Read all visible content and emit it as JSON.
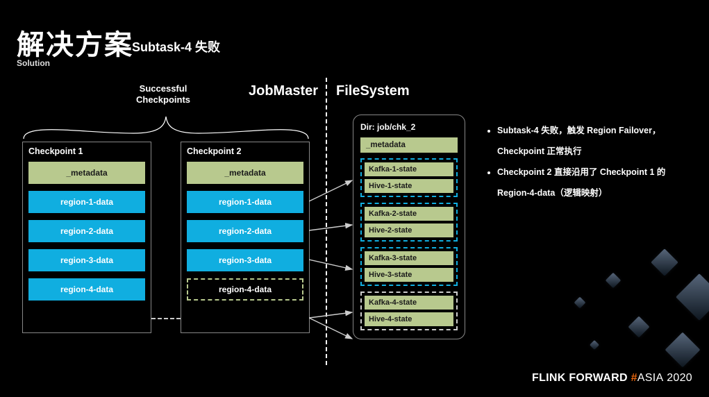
{
  "title": "解决方案",
  "title_en": "Solution",
  "scenario": "Subtask-4 失败",
  "labels": {
    "jobmaster": "JobMaster",
    "filesystem": "FileSystem",
    "successful_checkpoints_l1": "Successful",
    "successful_checkpoints_l2": "Checkpoints"
  },
  "checkpoints": [
    {
      "name": "Checkpoint 1",
      "rows": [
        {
          "label": "_metadata",
          "kind": "meta"
        },
        {
          "label": "region-1-data",
          "kind": "region"
        },
        {
          "label": "region-2-data",
          "kind": "region"
        },
        {
          "label": "region-3-data",
          "kind": "region"
        },
        {
          "label": "region-4-data",
          "kind": "region"
        }
      ]
    },
    {
      "name": "Checkpoint 2",
      "rows": [
        {
          "label": "_metadata",
          "kind": "meta"
        },
        {
          "label": "region-1-data",
          "kind": "region"
        },
        {
          "label": "region-2-data",
          "kind": "region"
        },
        {
          "label": "region-3-data",
          "kind": "region"
        },
        {
          "label": "region-4-data",
          "kind": "region-dashed"
        }
      ]
    }
  ],
  "filesystem": {
    "dir": "Dir: job/chk_2",
    "metadata": "_metadata",
    "groups": [
      {
        "states": [
          "Kafka-1-state",
          "Hive-1-state"
        ],
        "style": "blue"
      },
      {
        "states": [
          "Kafka-2-state",
          "Hive-2-state"
        ],
        "style": "blue"
      },
      {
        "states": [
          "Kafka-3-state",
          "Hive-3-state"
        ],
        "style": "blue"
      },
      {
        "states": [
          "Kafka-4-state",
          "Hive-4-state"
        ],
        "style": "grey"
      }
    ]
  },
  "bullets": [
    "Subtask-4 失败，触发 Region Failover，Checkpoint 正常执行",
    "Checkpoint 2 直接沿用了 Checkpoint 1 的 Region-4-data（逻辑映射）"
  ],
  "footer": {
    "brand": "FLINK FORWARD",
    "hash": "#",
    "asia": "ASIA",
    "year": "2020"
  },
  "chart_data": {
    "type": "table",
    "description": "Diagram showing two JobMaster checkpoints and a FileSystem directory layout; Checkpoint 2 reuses region-4-data from Checkpoint 1 (dashed) while regions 1-3 map to Kafka/Hive state files.",
    "checkpoint_1": [
      "_metadata",
      "region-1-data",
      "region-2-data",
      "region-3-data",
      "region-4-data"
    ],
    "checkpoint_2": [
      "_metadata",
      "region-1-data",
      "region-2-data",
      "region-3-data",
      "region-4-data (reused from chk_1)"
    ],
    "filesystem_dir": "job/chk_2",
    "filesystem_files": [
      "_metadata",
      "Kafka-1-state",
      "Hive-1-state",
      "Kafka-2-state",
      "Hive-2-state",
      "Kafka-3-state",
      "Hive-3-state",
      "Kafka-4-state",
      "Hive-4-state"
    ],
    "mapping": [
      {
        "from": "Checkpoint 2 / region-1-data",
        "to": [
          "Kafka-1-state",
          "Hive-1-state"
        ]
      },
      {
        "from": "Checkpoint 2 / region-2-data",
        "to": [
          "Kafka-2-state",
          "Hive-2-state"
        ]
      },
      {
        "from": "Checkpoint 2 / region-3-data",
        "to": [
          "Kafka-3-state",
          "Hive-3-state"
        ]
      },
      {
        "from": "Checkpoint 2 / region-4-data",
        "to": [
          "Kafka-4-state",
          "Hive-4-state"
        ]
      },
      {
        "from": "Checkpoint 1 / region-4-data",
        "to": "Checkpoint 2 / region-4-data",
        "relation": "reuse (logical mapping)"
      }
    ]
  }
}
